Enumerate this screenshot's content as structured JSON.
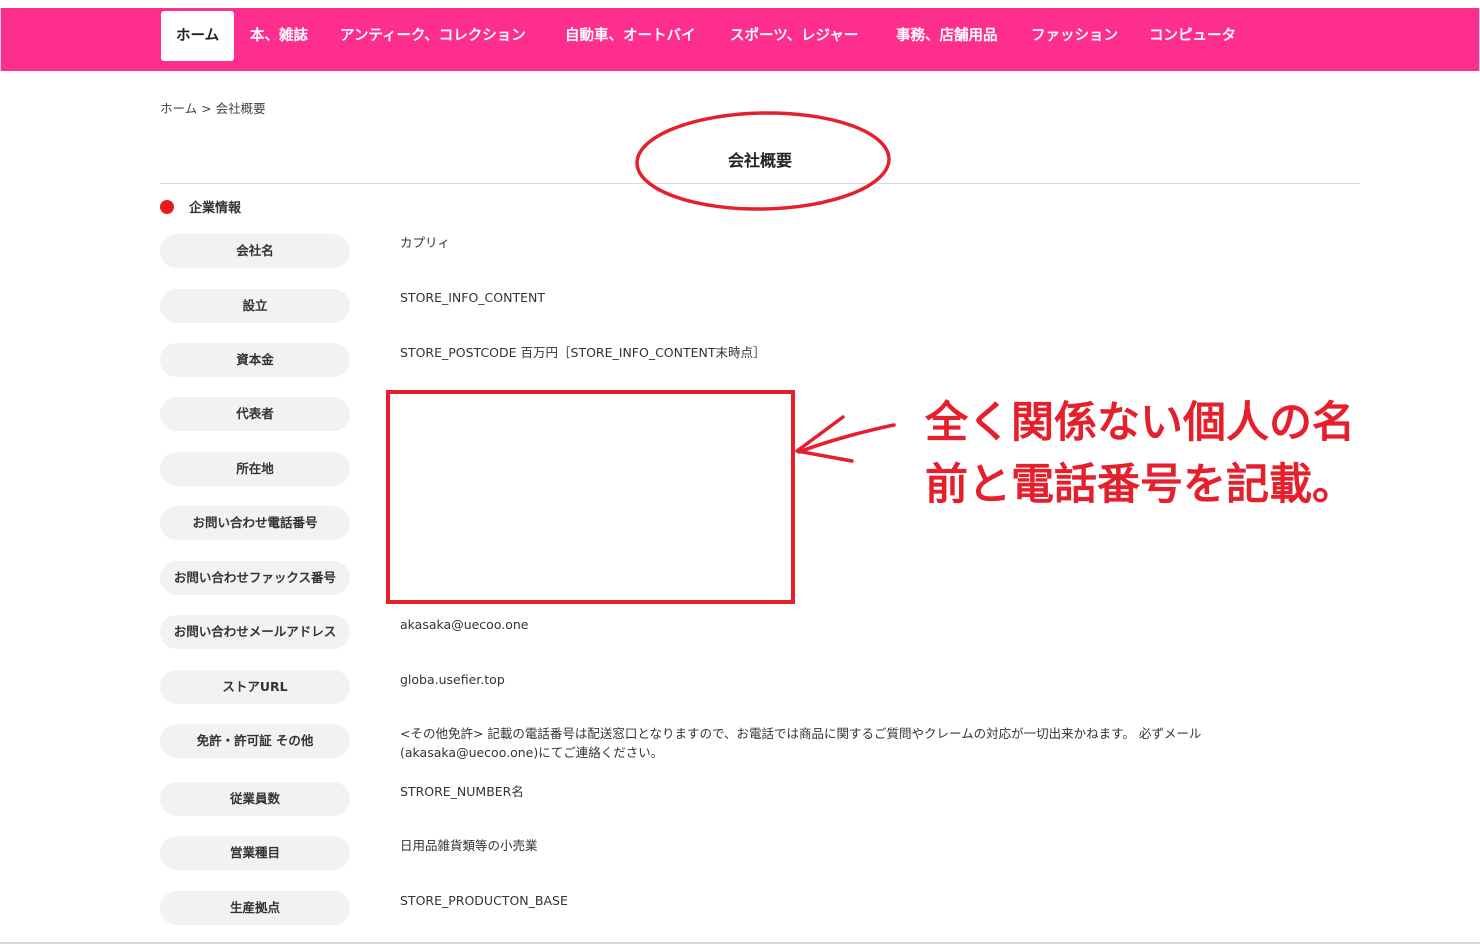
{
  "nav": {
    "items": [
      {
        "label": "ホーム",
        "active": true
      },
      {
        "label": "本、雑誌"
      },
      {
        "label": "アンティーク、コレクション"
      },
      {
        "label": "自動車、オートバイ"
      },
      {
        "label": "スポーツ、レジャー"
      },
      {
        "label": "事務、店舗用品"
      },
      {
        "label": "ファッション"
      },
      {
        "label": "コンピュータ"
      }
    ],
    "bg_color": "#fd2e8e"
  },
  "breadcrumb": {
    "home": "ホーム",
    "separator": " > ",
    "current": "会社概要"
  },
  "page_title": "会社概要",
  "section": {
    "title": "企業情報",
    "dot_color": "#e81c1c"
  },
  "rows": [
    {
      "label": "会社名",
      "value": "カプリィ"
    },
    {
      "label": "設立",
      "value": "STORE_INFO_CONTENT"
    },
    {
      "label": "資本金",
      "value": "STORE_POSTCODE 百万円［STORE_INFO_CONTENT末時点］"
    },
    {
      "label": "代表者",
      "value": ""
    },
    {
      "label": "所在地",
      "value": ""
    },
    {
      "label": "お問い合わせ電話番号",
      "value": ""
    },
    {
      "label": "お問い合わせファックス番号",
      "value": ""
    },
    {
      "label": "お問い合わせメールアドレス",
      "value": "akasaka@uecoo.one"
    },
    {
      "label": "ストアURL",
      "value": "globa.usefier.top"
    },
    {
      "label": "免許・許可証 その他",
      "value": "<その他免許> 記載の電話番号は配送窓口となりますので、お電話では商品に関するご質問やクレームの対応が一切出来かねます。 必ずメール(akasaka@uecoo.one)にてご連絡ください。"
    },
    {
      "label": "従業員数",
      "value": "STRORE_NUMBER名"
    },
    {
      "label": "営業種目",
      "value": "日用品雑貨類等の小売業"
    },
    {
      "label": "生産拠点",
      "value": "STORE_PRODUCTON_BASE"
    }
  ],
  "annotation": {
    "line1": "全く関係ない個人の名",
    "line2": "前と電話番号を記載。",
    "color": "#e51f2b"
  }
}
